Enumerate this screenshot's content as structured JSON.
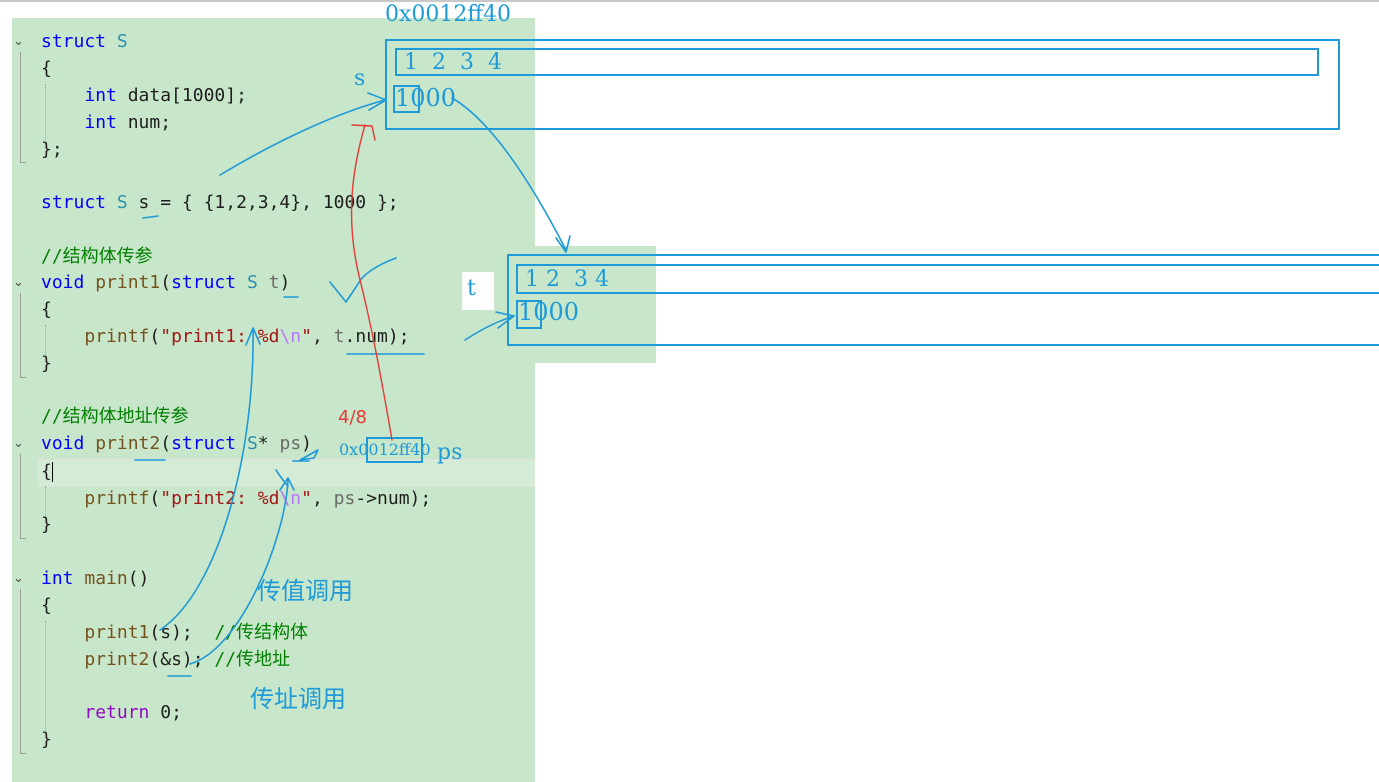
{
  "code": {
    "struct_decl": {
      "kw": "struct",
      "name": "S"
    },
    "open_brace_1": "{",
    "member_data": {
      "type": "int",
      "decl": " data[1000];"
    },
    "member_num": {
      "type": "int",
      "decl": " num;"
    },
    "close_struct": "};",
    "var_decl": {
      "kw": "struct",
      "name": "S",
      "rest": " s = { {1,2,3,4}, 1000 };"
    },
    "comment_1": "//结构体传参",
    "print1_sig": {
      "ret": "void",
      "fn": "print1",
      "p_open": "(",
      "kw": "struct",
      "ty": "S",
      "param": "t",
      "p_close": ")"
    },
    "open_brace_2": "{",
    "print1_body": {
      "fn": "printf",
      "open": "(",
      "str_a": "\"print1: %d",
      "esc": "\\n",
      "str_b": "\"",
      "sep": ", ",
      "param": "t",
      "tail": ".num);"
    },
    "close_brace_2": "}",
    "comment_2": "//结构体地址传参",
    "print2_sig": {
      "ret": "void",
      "fn": "print2",
      "p_open": "(",
      "kw": "struct",
      "ty": "S",
      "star": "* ",
      "param": "ps",
      "p_close": ")"
    },
    "open_brace_3": "{",
    "print2_body": {
      "fn": "printf",
      "open": "(",
      "str_a": "\"print2: %d",
      "esc": "\\n",
      "str_b": "\"",
      "sep": ", ",
      "param": "ps",
      "tail": "->num);"
    },
    "close_brace_3": "}",
    "main_sig": {
      "ret": "int",
      "fn": "main",
      "rest": "()"
    },
    "open_brace_4": "{",
    "call_1": {
      "fn": "print1",
      "args": "(s);",
      "gap": "  ",
      "cmt": "//传结构体"
    },
    "call_2": {
      "fn": "print2",
      "args": "(&s);",
      "gap": " ",
      "cmt": "//传地址"
    },
    "return_stmt": {
      "kw": "return",
      "rest": " 0;"
    },
    "close_brace_4": "}"
  },
  "annotations": {
    "address_top": "0x0012ff40",
    "s_label": "s",
    "s_array": "1  2  3  4",
    "s_num": "1000",
    "t_label": "t",
    "t_array": "1 2  3 4",
    "t_num": "1000",
    "ptr_size": "4/8",
    "ps_address": "0x0012ff40",
    "ps_label": "ps",
    "call_by_value": "传值调用",
    "call_by_address": "传址调用"
  },
  "colors": {
    "editor_bg": "#c8e6c9",
    "annotation_blue": "#1e9ad8",
    "annotation_red": "#e53935",
    "keyword": "#0000ff",
    "type": "#2b91af",
    "function": "#74531f",
    "string": "#a31515",
    "comment": "#008000",
    "control": "#8f08c4"
  },
  "icons": [
    "fold-chevron-icon"
  ]
}
